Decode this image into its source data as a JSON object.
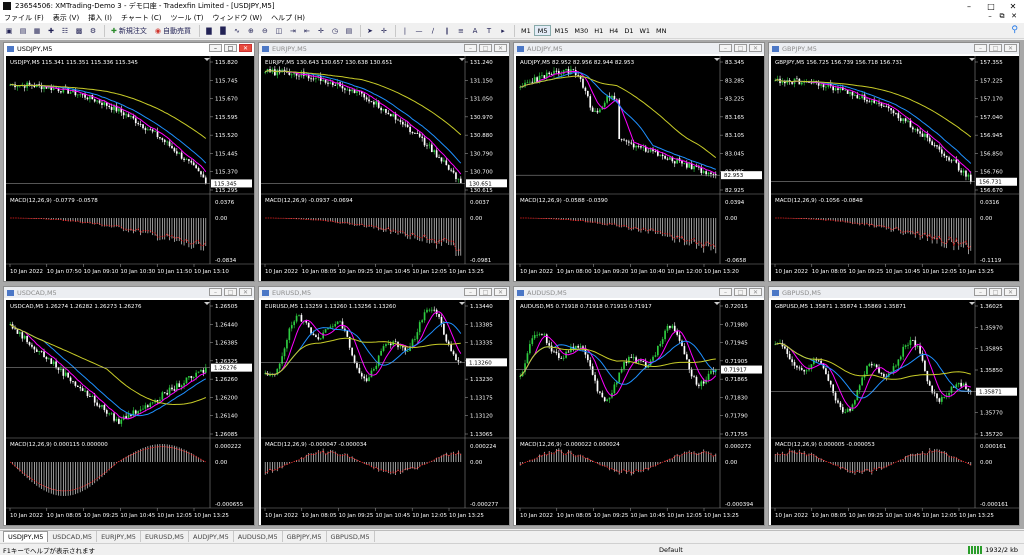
{
  "app": {
    "title": "23654506: XMTrading-Demo 3 - デモ口座 - Tradexfin Limited - [USDJPY,M5]"
  },
  "menu": [
    "ファイル (F)",
    "表示 (V)",
    "挿入 (I)",
    "チャート (C)",
    "ツール (T)",
    "ウィンドウ (W)",
    "ヘルプ (H)"
  ],
  "toolbar": {
    "new_order": "新規注文",
    "autotrade": "自動売買",
    "timeframes": [
      "M1",
      "M5",
      "M15",
      "M30",
      "H1",
      "H4",
      "D1",
      "W1",
      "MN"
    ],
    "active_tf": "M5"
  },
  "tabs": [
    "USDJPY,M5",
    "USDCAD,M5",
    "EURJPY,M5",
    "EURUSD,M5",
    "AUDJPY,M5",
    "AUDUSD,M5",
    "GBPJPY,M5",
    "GBPUSD,M5"
  ],
  "active_tab": "USDJPY,M5",
  "status": {
    "help": "F1キーでヘルプが表示されます",
    "profile": "Default",
    "traffic": "1932/2 kb"
  },
  "colors": {
    "bg": "#000000",
    "candle": "#ffffff",
    "ma_fast": "#ff00ff",
    "ma_mid": "#1e90ff",
    "ma_slow": "#c8cc28",
    "grid": "#3a3a3a",
    "signal": "#ff2020"
  },
  "charts": [
    {
      "title": "USDJPY,M5",
      "info": "USDJPY,M5  115.341 115.351 115.336 115.345",
      "prices": [
        "115.820",
        "115.745",
        "115.670",
        "115.595",
        "115.520",
        "115.445",
        "115.370",
        "115.295"
      ],
      "last": "115.345",
      "start": 0.82,
      "end": 0.06,
      "shape": "down",
      "macd_info": "MACD(12,26,9) -0.0779 -0.0578",
      "macd_axis": [
        "0.0376",
        "0.00",
        "-0.0834"
      ],
      "times": [
        "10 Jan 2022",
        "10 Jan 07:50",
        "10 Jan 09:10",
        "10 Jan 10:30",
        "10 Jan 11:50",
        "10 Jan 13:10"
      ]
    },
    {
      "title": "EURJPY,M5",
      "info": "EURJPY,M5  130.643 130.657 130.638 130.651",
      "prices": [
        "131.240",
        "131.150",
        "131.050",
        "130.970",
        "130.880",
        "130.790",
        "130.700",
        "130.615"
      ],
      "last": "130.651",
      "start": 0.92,
      "end": 0.04,
      "shape": "down",
      "macd_info": "MACD(12,26,9) -0.0937 -0.0694",
      "macd_axis": [
        "0.0037",
        "0.00",
        "-0.0981"
      ],
      "times": [
        "10 Jan 2022",
        "10 Jan 08:05",
        "10 Jan 09:25",
        "10 Jan 10:45",
        "10 Jan 12:05",
        "10 Jan 13:25"
      ]
    },
    {
      "title": "AUDJPY,M5",
      "info": "AUDJPY,M5  82.952 82.956 82.944 82.953",
      "prices": [
        "83.345",
        "83.285",
        "83.225",
        "83.165",
        "83.105",
        "83.045",
        "82.985",
        "82.925"
      ],
      "last": "82.953",
      "start": 0.8,
      "end": 0.05,
      "shape": "dip",
      "macd_info": "MACD(12,26,9) -0.0588 -0.0390",
      "macd_axis": [
        "0.0394",
        "0.00",
        "-0.0658"
      ],
      "times": [
        "10 Jan 2022",
        "10 Jan 08:00",
        "10 Jan 09:20",
        "10 Jan 10:40",
        "10 Jan 12:00",
        "10 Jan 13:20"
      ]
    },
    {
      "title": "GBPJPY,M5",
      "info": "GBPJPY,M5  156.725 156.739 156.718 156.731",
      "prices": [
        "157.355",
        "157.225",
        "157.170",
        "157.040",
        "156.945",
        "156.850",
        "156.760",
        "156.670"
      ],
      "last": "156.731",
      "start": 0.85,
      "end": 0.06,
      "shape": "down",
      "macd_info": "MACD(12,26,9) -0.1056 -0.0848",
      "macd_axis": [
        "0.0316",
        "0.00",
        "-0.1119"
      ],
      "times": [
        "10 Jan 2022",
        "10 Jan 08:05",
        "10 Jan 09:25",
        "10 Jan 10:45",
        "10 Jan 12:05",
        "10 Jan 13:25"
      ]
    },
    {
      "title": "USDCAD,M5",
      "info": "USDCAD,M5  1.26274 1.26282 1.26273 1.26276",
      "prices": [
        "1.26505",
        "1.26440",
        "1.26385",
        "1.26325",
        "1.26260",
        "1.26200",
        "1.26140",
        "1.26085"
      ],
      "last": "1.26276",
      "start": 0.85,
      "end": 0.5,
      "shape": "v",
      "macd_info": "MACD(12,26,9) 0.000115 0.000000",
      "macd_axis": [
        "0.000222",
        "0.00",
        "-0.000655"
      ],
      "times": [
        "10 Jan 2022",
        "10 Jan 08:05",
        "10 Jan 09:25",
        "10 Jan 10:45",
        "10 Jan 12:05",
        "10 Jan 13:25"
      ]
    },
    {
      "title": "EURUSD,M5",
      "info": "EURUSD,M5  1.13259 1.13260 1.13256 1.13260",
      "prices": [
        "1.13440",
        "1.13385",
        "1.13335",
        "1.13285",
        "1.13230",
        "1.13175",
        "1.13120",
        "1.13065"
      ],
      "last": "1.13260",
      "start": 0.7,
      "end": 0.45,
      "shape": "wave",
      "macd_info": "MACD(12,26,9) -0.000047 -0.000034",
      "macd_axis": [
        "0.000224",
        "0.00",
        "-0.000277"
      ],
      "times": [
        "10 Jan 2022",
        "10 Jan 08:05",
        "10 Jan 09:25",
        "10 Jan 10:45",
        "10 Jan 12:05",
        "10 Jan 13:25"
      ]
    },
    {
      "title": "AUDUSD,M5",
      "info": "AUDUSD,M5  0.71918 0.71918 0.71915 0.71917",
      "prices": [
        "0.72015",
        "0.71980",
        "0.71945",
        "0.71905",
        "0.71865",
        "0.71830",
        "0.71790",
        "0.71755"
      ],
      "last": "0.71917",
      "start": 0.55,
      "end": 0.55,
      "shape": "wave",
      "macd_info": "MACD(12,26,9) -0.000022 0.000024",
      "macd_axis": [
        "0.000272",
        "0.00",
        "-0.000394"
      ],
      "times": [
        "10 Jan 2022",
        "10 Jan 08:05",
        "10 Jan 09:25",
        "10 Jan 10:45",
        "10 Jan 12:05",
        "10 Jan 13:25"
      ]
    },
    {
      "title": "GBPUSD,M5",
      "info": "GBPUSD,M5  1.35871 1.35874 1.35869 1.35871",
      "prices": [
        "1.36025",
        "1.35970",
        "1.35895",
        "1.35850",
        "1.35810",
        "1.35770",
        "1.35720"
      ],
      "last": "1.35871",
      "start": 0.45,
      "end": 0.55,
      "shape": "wave",
      "macd_info": "MACD(12,26,9) 0.000005 -0.000053",
      "macd_axis": [
        "0.000161",
        "0.00",
        "-0.000161"
      ],
      "times": [
        "10 Jan 2022",
        "10 Jan 08:05",
        "10 Jan 09:25",
        "10 Jan 10:45",
        "10 Jan 12:05",
        "10 Jan 13:25"
      ]
    }
  ]
}
